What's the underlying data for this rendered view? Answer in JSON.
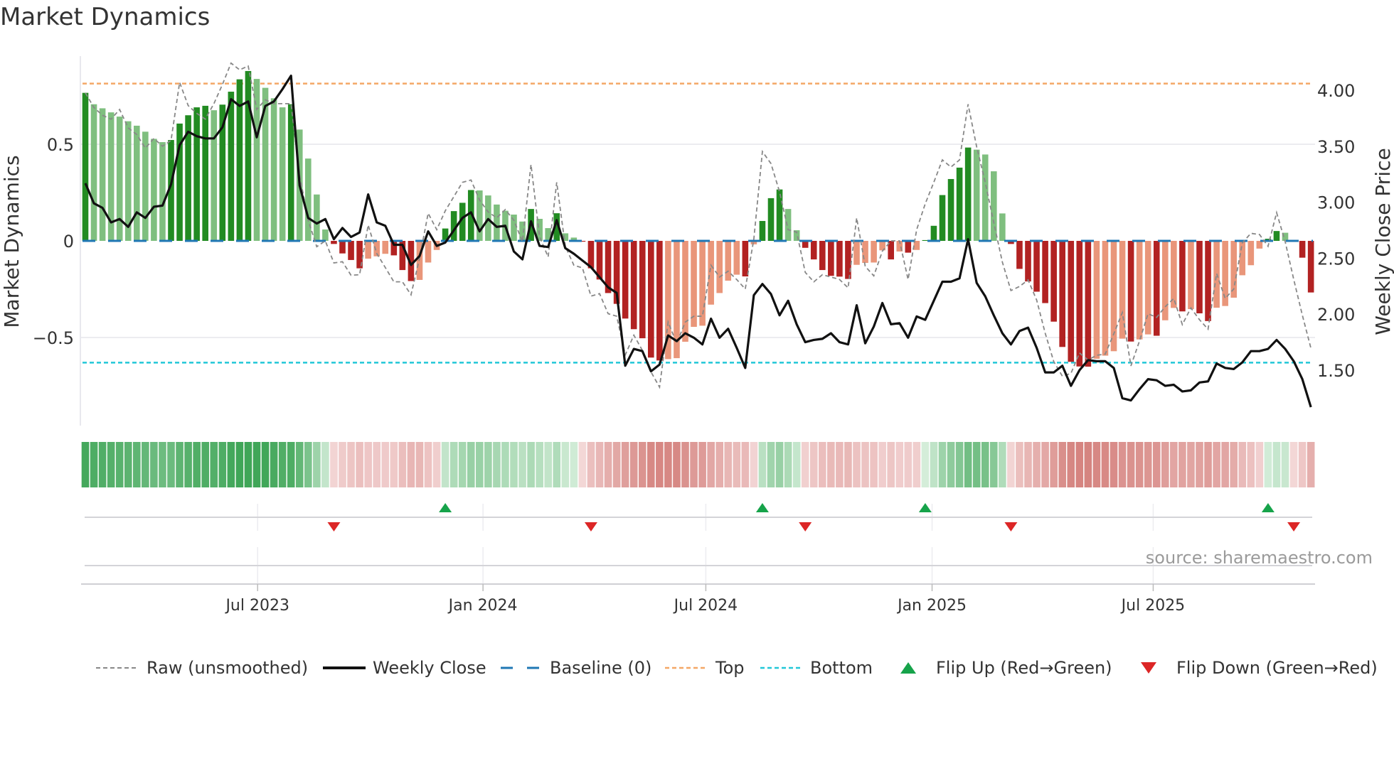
{
  "title": "Market Dynamics",
  "source": "source: sharemaestro.com",
  "colors": {
    "up_strong": "#228b22",
    "up_weak": "#7fbf7f",
    "down_strong": "#b22222",
    "down_weak": "#e9967a",
    "close": "#111111",
    "raw": "#888888",
    "baseline": "#1f77b4",
    "top": "#f4a766",
    "bottom": "#22c7d8",
    "flip_up": "#16a34a",
    "flip_down": "#dc2626"
  },
  "legend": [
    {
      "key": "raw",
      "label": "Raw (unsmoothed)"
    },
    {
      "key": "close",
      "label": "Weekly Close"
    },
    {
      "key": "baseline",
      "label": "Baseline (0)"
    },
    {
      "key": "top",
      "label": "Top"
    },
    {
      "key": "bottom",
      "label": "Bottom"
    },
    {
      "key": "flip_up",
      "label": "Flip Up (Red→Green)"
    },
    {
      "key": "flip_down",
      "label": "Flip Down (Green→Red)"
    }
  ],
  "chart_data": {
    "type": "bar",
    "title": "Market Dynamics",
    "ylabel": "Market Dynamics",
    "ylabel_right": "Weekly Close Price",
    "xlabel": "",
    "ylim": [
      -0.956,
      0.956
    ],
    "ylim_right": [
      1.005,
      4.305
    ],
    "yticks": [
      {
        "value": 0.5,
        "label": "0.5"
      },
      {
        "value": 0,
        "label": "0"
      },
      {
        "value": -0.5,
        "label": "−0.5"
      }
    ],
    "yticks_right": [
      {
        "value": 4.0,
        "label": "4.00"
      },
      {
        "value": 3.5,
        "label": "3.50"
      },
      {
        "value": 3.0,
        "label": "3.00"
      },
      {
        "value": 2.5,
        "label": "2.50"
      },
      {
        "value": 2.0,
        "label": "2.00"
      },
      {
        "value": 1.5,
        "label": "1.50"
      }
    ],
    "x_ticks": [
      {
        "label": "Jul 2023",
        "week": 20.1
      },
      {
        "label": "Jan 2024",
        "week": 46.4
      },
      {
        "label": "Jul 2024",
        "week": 72.4
      },
      {
        "label": "Jan 2025",
        "week": 98.8
      },
      {
        "label": "Jul 2025",
        "week": 124.6
      }
    ],
    "grid": true,
    "legend_position": "bottom",
    "top_level": 0.814,
    "bottom_level": -0.63,
    "baseline": 0,
    "series": [
      {
        "name": "Market Dynamics",
        "type": "bar",
        "values": [
          0.766,
          0.707,
          0.686,
          0.665,
          0.643,
          0.619,
          0.596,
          0.565,
          0.528,
          0.511,
          0.522,
          0.607,
          0.65,
          0.691,
          0.699,
          0.676,
          0.705,
          0.772,
          0.836,
          0.879,
          0.838,
          0.792,
          0.738,
          0.691,
          0.707,
          0.576,
          0.426,
          0.24,
          0.059,
          -0.016,
          -0.065,
          -0.099,
          -0.142,
          -0.092,
          -0.08,
          -0.067,
          -0.075,
          -0.151,
          -0.208,
          -0.202,
          -0.112,
          -0.047,
          0.064,
          0.154,
          0.197,
          0.263,
          0.261,
          0.235,
          0.188,
          0.156,
          0.136,
          0.1,
          0.165,
          0.114,
          0.066,
          0.143,
          0.039,
          0.017,
          -0.004,
          -0.142,
          -0.2,
          -0.27,
          -0.326,
          -0.402,
          -0.457,
          -0.504,
          -0.604,
          -0.619,
          -0.612,
          -0.607,
          -0.522,
          -0.445,
          -0.439,
          -0.33,
          -0.27,
          -0.206,
          -0.175,
          -0.184,
          -0.018,
          0.103,
          0.221,
          0.266,
          0.165,
          0.055,
          -0.036,
          -0.096,
          -0.151,
          -0.181,
          -0.185,
          -0.197,
          -0.124,
          -0.114,
          -0.112,
          -0.049,
          -0.096,
          -0.055,
          -0.061,
          -0.047,
          0.004,
          0.078,
          0.237,
          0.32,
          0.379,
          0.483,
          0.472,
          0.447,
          0.36,
          0.142,
          -0.016,
          -0.145,
          -0.21,
          -0.263,
          -0.322,
          -0.418,
          -0.549,
          -0.626,
          -0.65,
          -0.651,
          -0.61,
          -0.594,
          -0.571,
          -0.506,
          -0.521,
          -0.51,
          -0.484,
          -0.491,
          -0.411,
          -0.347,
          -0.365,
          -0.353,
          -0.375,
          -0.415,
          -0.346,
          -0.337,
          -0.294,
          -0.178,
          -0.126,
          -0.04,
          0.011,
          0.051,
          0.042,
          -0.004,
          -0.087,
          -0.267
        ]
      },
      {
        "name": "Raw (unsmoothed)",
        "type": "line",
        "values": [
          0.766,
          0.69,
          0.65,
          0.63,
          0.68,
          0.585,
          0.55,
          0.48,
          0.53,
          0.49,
          0.52,
          0.82,
          0.7,
          0.66,
          0.63,
          0.71,
          0.81,
          0.92,
          0.885,
          0.905,
          0.68,
          0.73,
          0.71,
          0.71,
          0.71,
          0.34,
          0.107,
          -0.03,
          0.0,
          -0.114,
          -0.108,
          -0.178,
          -0.175,
          0.082,
          -0.065,
          -0.138,
          -0.212,
          -0.212,
          -0.279,
          -0.089,
          0.143,
          0.058,
          0.156,
          0.229,
          0.303,
          0.315,
          0.211,
          0.15,
          0.119,
          0.162,
          0.107,
          -0.004,
          0.395,
          0.021,
          -0.083,
          0.303,
          -0.028,
          -0.126,
          -0.14,
          -0.286,
          -0.273,
          -0.377,
          -0.39,
          -0.59,
          -0.488,
          -0.567,
          -0.678,
          -0.757,
          -0.42,
          -0.531,
          -0.42,
          -0.39,
          -0.39,
          -0.126,
          -0.187,
          -0.157,
          -0.2,
          -0.249,
          0.009,
          0.462,
          0.4,
          0.254,
          0.058,
          0.045,
          -0.163,
          -0.212,
          -0.175,
          -0.187,
          -0.2,
          -0.243,
          0.119,
          -0.132,
          -0.181,
          -0.053,
          0.0,
          0.0,
          -0.2,
          0.058,
          0.192,
          0.303,
          0.419,
          0.382,
          0.419,
          0.707,
          0.487,
          0.303,
          0.094,
          -0.11,
          -0.257,
          -0.236,
          -0.202,
          -0.306,
          -0.478,
          -0.625,
          -0.7,
          -0.686,
          -0.58,
          -0.616,
          -0.592,
          -0.586,
          -0.481,
          -0.371,
          -0.647,
          -0.518,
          -0.377,
          -0.396,
          -0.341,
          -0.298,
          -0.433,
          -0.347,
          -0.408,
          -0.457,
          -0.169,
          -0.298,
          -0.249,
          -0.01,
          0.039,
          0.033,
          -0.028,
          0.146,
          -0.004,
          -0.2,
          -0.384,
          -0.555
        ]
      },
      {
        "name": "Weekly Close",
        "type": "line",
        "axis": "right",
        "values": [
          3.17,
          2.99,
          2.95,
          2.82,
          2.85,
          2.78,
          2.91,
          2.86,
          2.96,
          2.97,
          3.16,
          3.51,
          3.63,
          3.59,
          3.57,
          3.57,
          3.67,
          3.92,
          3.86,
          3.9,
          3.58,
          3.86,
          3.9,
          4.01,
          4.13,
          3.15,
          2.86,
          2.81,
          2.85,
          2.67,
          2.77,
          2.69,
          2.73,
          3.07,
          2.82,
          2.79,
          2.62,
          2.62,
          2.44,
          2.52,
          2.74,
          2.61,
          2.64,
          2.75,
          2.86,
          2.91,
          2.74,
          2.85,
          2.78,
          2.79,
          2.56,
          2.49,
          2.83,
          2.61,
          2.6,
          2.84,
          2.59,
          2.54,
          2.48,
          2.42,
          2.33,
          2.24,
          2.19,
          1.54,
          1.69,
          1.67,
          1.49,
          1.55,
          1.81,
          1.76,
          1.83,
          1.79,
          1.73,
          1.96,
          1.79,
          1.87,
          1.7,
          1.52,
          2.17,
          2.27,
          2.18,
          1.99,
          2.12,
          1.91,
          1.75,
          1.77,
          1.78,
          1.83,
          1.75,
          1.73,
          2.08,
          1.74,
          1.89,
          2.1,
          1.91,
          1.92,
          1.79,
          1.98,
          1.95,
          2.12,
          2.29,
          2.29,
          2.32,
          2.67,
          2.28,
          2.16,
          1.99,
          1.83,
          1.73,
          1.85,
          1.88,
          1.7,
          1.48,
          1.48,
          1.54,
          1.36,
          1.5,
          1.59,
          1.58,
          1.58,
          1.52,
          1.25,
          1.23,
          1.33,
          1.42,
          1.41,
          1.36,
          1.37,
          1.31,
          1.32,
          1.39,
          1.4,
          1.56,
          1.52,
          1.51,
          1.57,
          1.67,
          1.67,
          1.69,
          1.77,
          1.69,
          1.58,
          1.42,
          1.17
        ]
      }
    ],
    "flip_up_weeks": [
      43,
      80,
      99,
      139
    ],
    "flip_down_weeks": [
      30,
      60,
      85,
      109,
      142
    ]
  }
}
